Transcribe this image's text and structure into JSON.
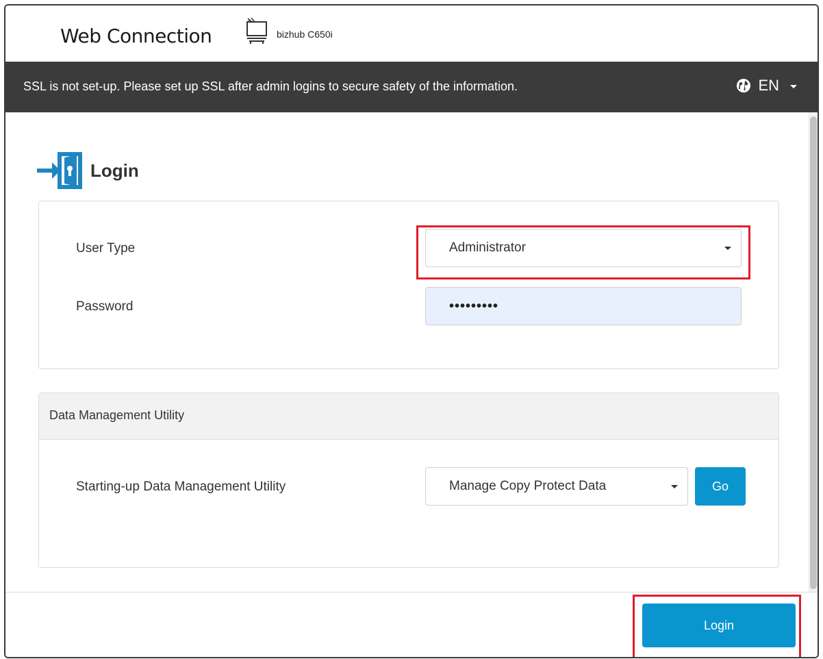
{
  "header": {
    "brand": "Web Connection",
    "model": "bizhub C650i",
    "printer_icon": "printer-icon"
  },
  "ssl_bar": {
    "message": "SSL is not set-up. Please set up SSL after admin logins to secure safety of the information.",
    "language": "EN",
    "language_icon": "globe-icon"
  },
  "login": {
    "title": "Login",
    "icon": "login-door-icon",
    "user_type_label": "User Type",
    "user_type_value": "Administrator",
    "password_label": "Password",
    "password_value": "•••••••••"
  },
  "dmu": {
    "header": "Data Management Utility",
    "label": "Starting-up Data Management Utility",
    "select_value": "Manage Copy Protect Data",
    "go_label": "Go"
  },
  "footer": {
    "login_button": "Login"
  },
  "colors": {
    "accent": "#0a95cf",
    "bar": "#3b3b3b",
    "highlight": "#e01d2d",
    "autofill": "#e8f0fe"
  }
}
